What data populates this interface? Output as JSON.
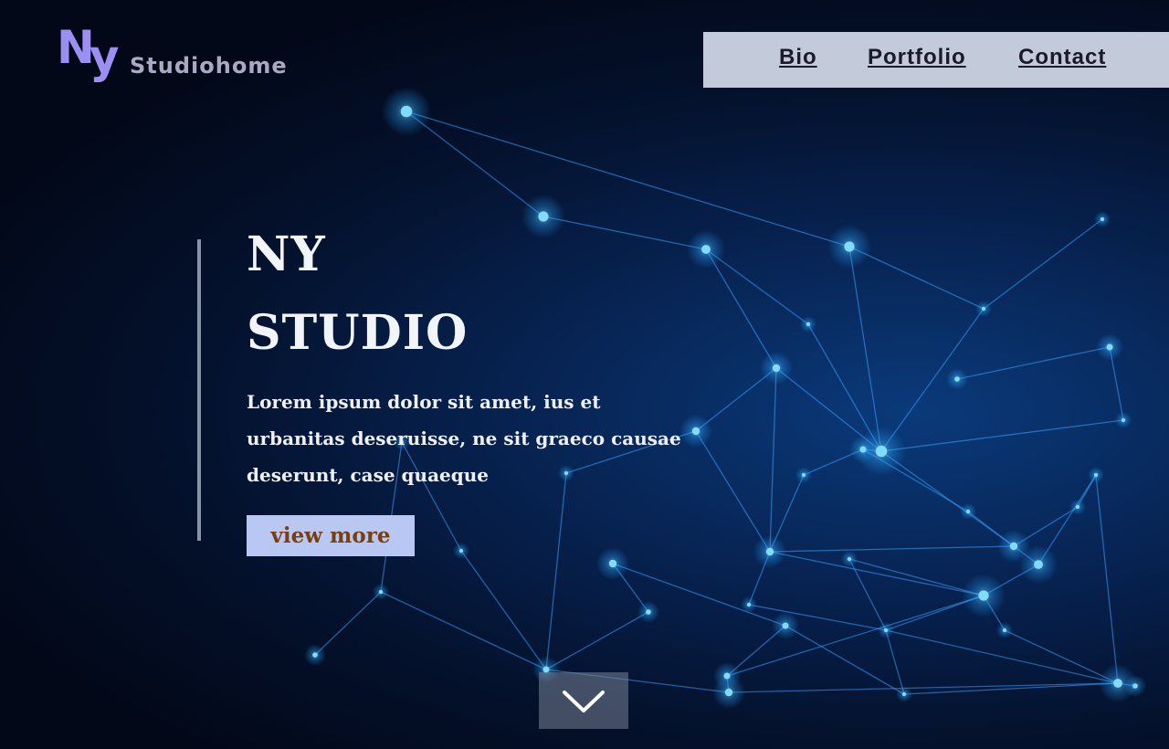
{
  "brand": {
    "mark_n": "N",
    "mark_y": "y",
    "name": "Studiohome",
    "mark_color": "#9c8ff2"
  },
  "nav": {
    "items": [
      {
        "label": "Bio"
      },
      {
        "label": "Portfolio"
      },
      {
        "label": "Contact"
      }
    ],
    "background": "#c3cad9"
  },
  "hero": {
    "title_line1": "NY",
    "title_line2": "STUDIO",
    "body_line1": "Lorem ipsum dolor sit amet, ius et",
    "body_line2": "urbanitas deseruisse, ne sit graeco causae",
    "body_line3": "deserunt, case quaeque",
    "cta_label": "view more",
    "cta_bg": "#b8c8f2",
    "cta_text_color": "#7a3e10"
  },
  "scroll": {
    "icon": "chevron-down-icon"
  },
  "background": {
    "theme": "blue-network-plexus",
    "accent": "#2aa8ff"
  }
}
